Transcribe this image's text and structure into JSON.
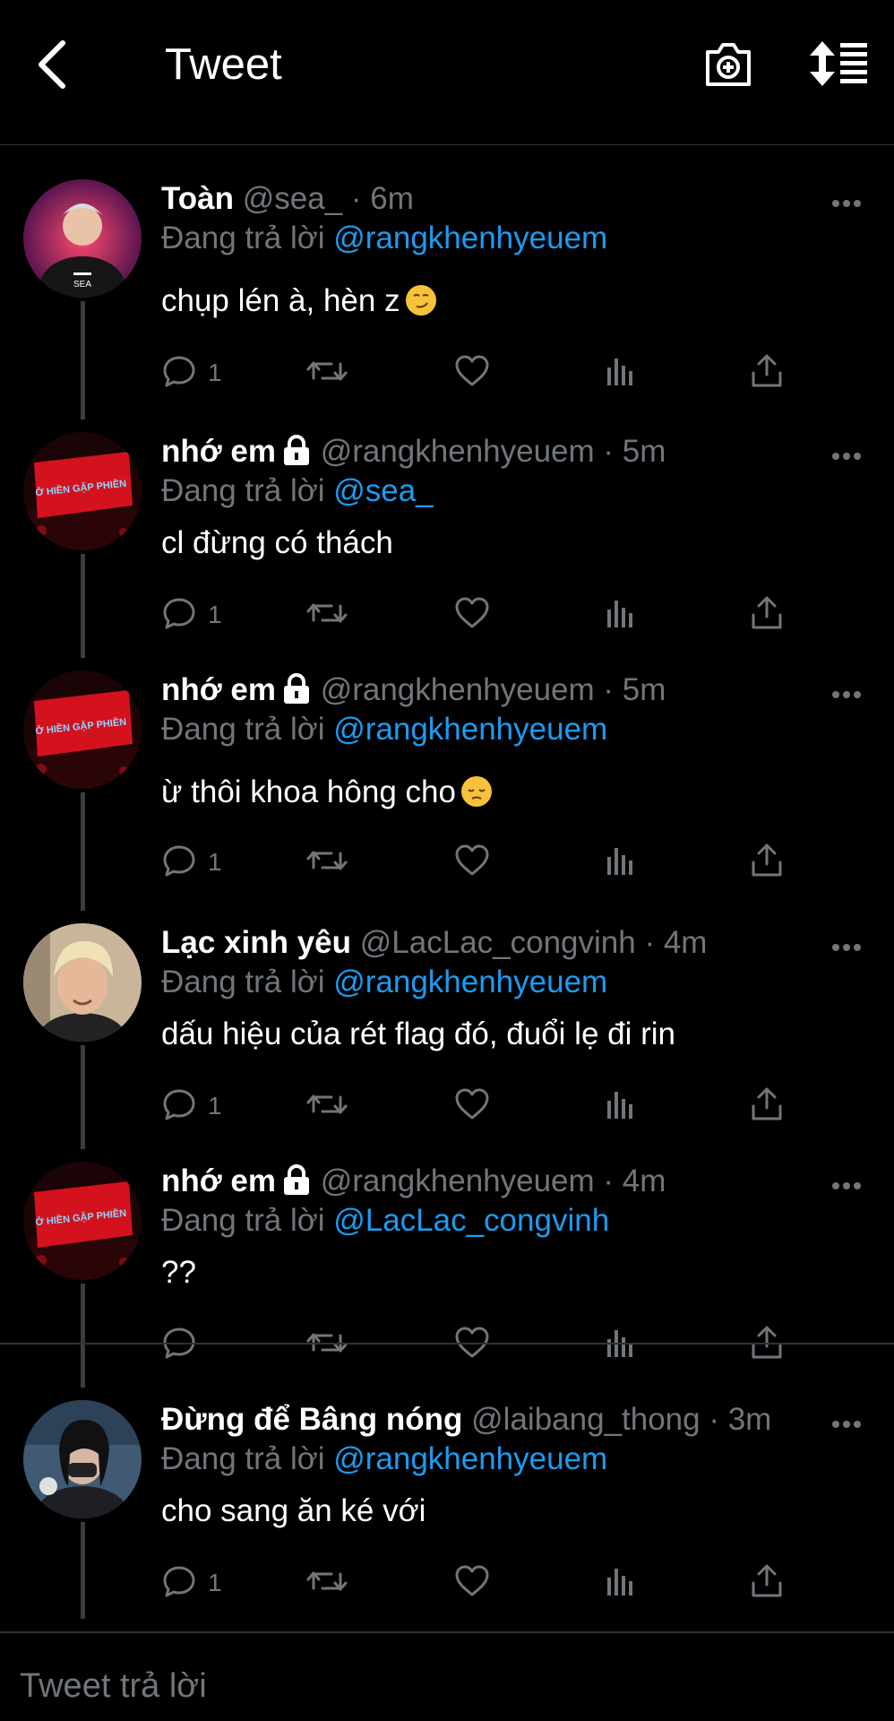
{
  "header": {
    "title": "Tweet",
    "back_icon": "chevron-left-icon",
    "camera_icon": "camera-plus-icon",
    "sort_icon": "sort-icon"
  },
  "tweets": [
    {
      "name": "Toàn",
      "handle": "@sea_ · 6m",
      "reply_prefix": "Đang trả lời",
      "reply_to": "@rangkhenhyeuem",
      "text": "chụp lén à, hèn z",
      "emoji": "smirk",
      "reply_count": "1",
      "locked": false
    },
    {
      "name": "nhớ em",
      "handle": "@rangkhenhyeuem · 5m",
      "reply_prefix": "Đang trả lời",
      "reply_to": "@sea_",
      "text": "cl đừng có thách",
      "reply_count": "1",
      "locked": true
    },
    {
      "name": "nhớ em",
      "handle": "@rangkhenhyeuem · 5m",
      "reply_prefix": "Đang trả lời",
      "reply_to": "@rangkhenhyeuem",
      "text": "ừ thôi khoa hông cho",
      "emoji": "pensive",
      "reply_count": "1",
      "locked": true
    },
    {
      "name": "Lạc xinh yêu",
      "handle": "@LacLac_congvinh · 4m",
      "reply_prefix": "Đang trả lời",
      "reply_to": "@rangkhenhyeuem",
      "text": "dấu hiệu của rét flag đó, đuổi lẹ đi rin",
      "reply_count": "1",
      "locked": false
    },
    {
      "name": "nhớ em",
      "handle": "@rangkhenhyeuem · 4m",
      "reply_prefix": "Đang trả lời",
      "reply_to": "@LacLac_congvinh",
      "text": "??",
      "reply_count": "",
      "locked": true
    },
    {
      "name": "Đừng để Bâng nóng",
      "handle": "@laibang_thong · 3m",
      "reply_prefix": "Đang trả lời",
      "reply_to": "@rangkhenhyeuem",
      "text": "cho sang ăn ké với",
      "reply_count": "1",
      "locked": false
    }
  ],
  "avatar_labels": {
    "sign": "Ở HIỀN GẶP PHIỀN",
    "sea": "SEA"
  },
  "composer": {
    "placeholder": "Tweet trả lời"
  },
  "colors": {
    "background": "#000000",
    "accent": "#1d9bf0",
    "muted": "#71767b"
  }
}
